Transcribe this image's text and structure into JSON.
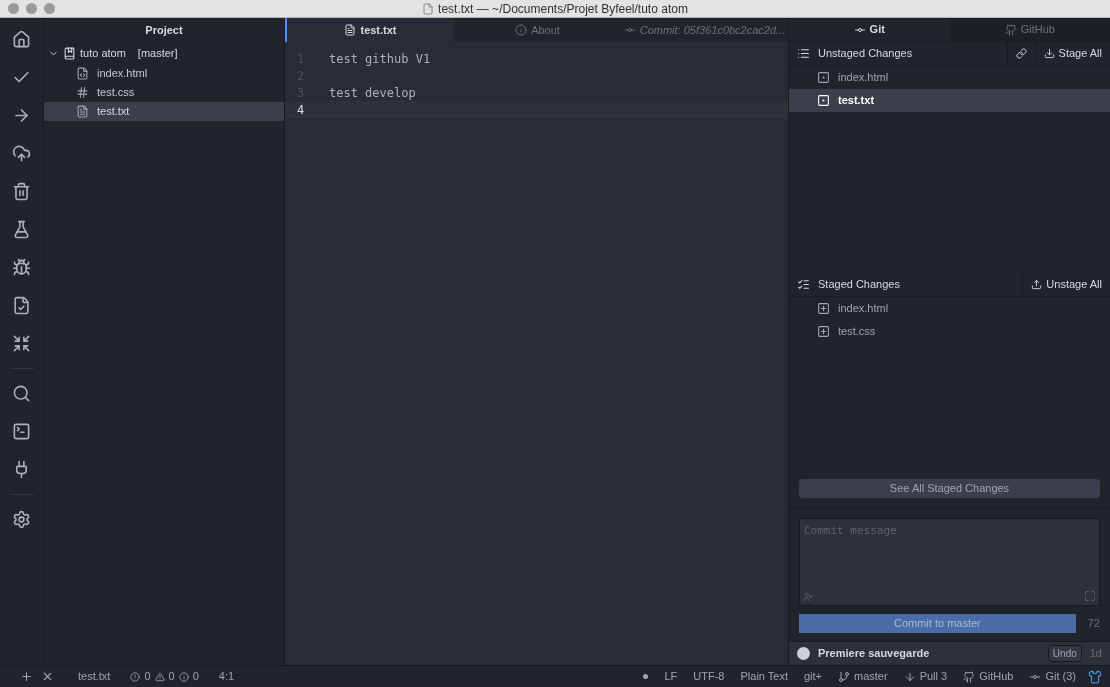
{
  "window": {
    "title": "test.txt — ~/Documents/Projet Byfeel/tuto atom"
  },
  "tree_view": {
    "title": "Project",
    "root": {
      "name": "tuto atom",
      "branch": "[master]",
      "expanded": true,
      "children": [
        {
          "name": "index.html",
          "kind": "html",
          "selected": false
        },
        {
          "name": "test.css",
          "kind": "css",
          "selected": false
        },
        {
          "name": "test.txt",
          "kind": "text",
          "selected": true
        }
      ]
    }
  },
  "editor": {
    "tabs": [
      {
        "label": "test.txt",
        "kind": "file",
        "selected": true
      },
      {
        "label": "About",
        "kind": "about",
        "selected": false
      },
      {
        "label": "Commit: 05f361c0bc2cac2d...",
        "kind": "commit",
        "selected": false
      }
    ],
    "lines": [
      {
        "number": "1",
        "text": "test github V1",
        "current": false
      },
      {
        "number": "2",
        "current": false
      },
      {
        "number": "3",
        "text": "test develop",
        "current": false
      },
      {
        "number": "4",
        "current": true
      }
    ]
  },
  "git_panel": {
    "tabs": [
      {
        "label": "Git",
        "kind": "git",
        "selected": true
      },
      {
        "label": "GitHub",
        "kind": "github",
        "selected": false
      }
    ],
    "unstaged": {
      "title": "Unstaged Changes",
      "action": "Stage All",
      "files": [
        {
          "name": "index.html",
          "selected": false
        },
        {
          "name": "test.txt",
          "selected": true
        }
      ]
    },
    "staged": {
      "title": "Staged Changes",
      "action": "Unstage All",
      "files": [
        {
          "name": "index.html",
          "selected": false
        },
        {
          "name": "test.css",
          "selected": false
        }
      ]
    },
    "see_all_button": "See All Staged Changes",
    "commit_message": {
      "placeholder": "Commit message"
    },
    "commit_button": "Commit to master",
    "remaining_chars": "72",
    "recent_commit": {
      "message": "Premiere sauvegarde",
      "undo": "Undo",
      "age": "1d"
    }
  },
  "status_bar": {
    "file": "test.txt",
    "errors": "0",
    "warnings": "0",
    "infos": "0",
    "cursor": "4:1",
    "right": [
      {
        "kind": "plain",
        "label": "LF"
      },
      {
        "kind": "plain",
        "label": "UTF-8"
      },
      {
        "kind": "plain",
        "label": "Plain Text"
      },
      {
        "kind": "plain",
        "label": "git+"
      },
      {
        "kind": "branch",
        "label": "master"
      },
      {
        "kind": "pull",
        "label": "Pull 3"
      },
      {
        "kind": "github",
        "label": "GitHub"
      },
      {
        "kind": "git",
        "label": "Git (3)"
      }
    ]
  }
}
